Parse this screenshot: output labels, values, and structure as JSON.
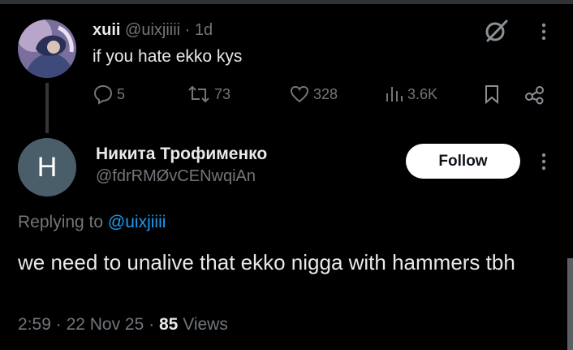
{
  "parent_tweet": {
    "display_name": "xuii",
    "handle": "@uixjiiii",
    "separator": "·",
    "time": "1d",
    "text": "if you hate ekko kys",
    "stats": {
      "replies": "5",
      "reposts": "73",
      "likes": "328",
      "views": "3.6K"
    },
    "icons": [
      "grok-icon",
      "more-icon",
      "reply-icon",
      "repost-icon",
      "like-icon",
      "views-icon",
      "bookmark-icon",
      "share-icon"
    ]
  },
  "main_tweet": {
    "avatar_letter": "H",
    "display_name": "Никита Трофименко",
    "handle": "@fdrRMØvCENwqiAn",
    "follow_label": "Follow",
    "replying_prefix": "Replying to",
    "replying_handle": "@uixjiiii",
    "text": "we need to unalive that ekko nigga with hammers tbh",
    "time": "2:59",
    "date": "22 Nov 25",
    "separator": "·",
    "views_count": "85",
    "views_label": "Views"
  },
  "colors": {
    "background": "#000000",
    "text": "#e7e9ea",
    "secondary": "#71767b",
    "link": "#1d9bf0",
    "avatar_bg": "#4a5e6a"
  }
}
